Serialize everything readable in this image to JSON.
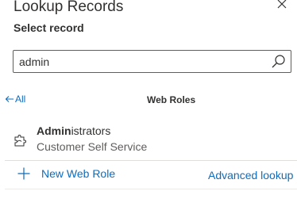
{
  "dialog": {
    "title": "Lookup Records",
    "subtitle": "Select record"
  },
  "search": {
    "value": "admin"
  },
  "list": {
    "back_label": "All",
    "view_title": "Web Roles"
  },
  "results": [
    {
      "name_match": "Admin",
      "name_rest": "istrators",
      "subtitle": "Customer Self Service"
    }
  ],
  "footer": {
    "new_label": "New Web Role",
    "advanced_label": "Advanced lookup"
  },
  "colors": {
    "link": "#0f6cbd",
    "text": "#323130",
    "secondary_text": "#605e5c",
    "border": "#605e5c"
  },
  "icons": {
    "close": "close-icon",
    "search": "search-icon",
    "back": "back-arrow-icon",
    "record": "puzzle-entity-icon",
    "add": "plus-icon"
  }
}
